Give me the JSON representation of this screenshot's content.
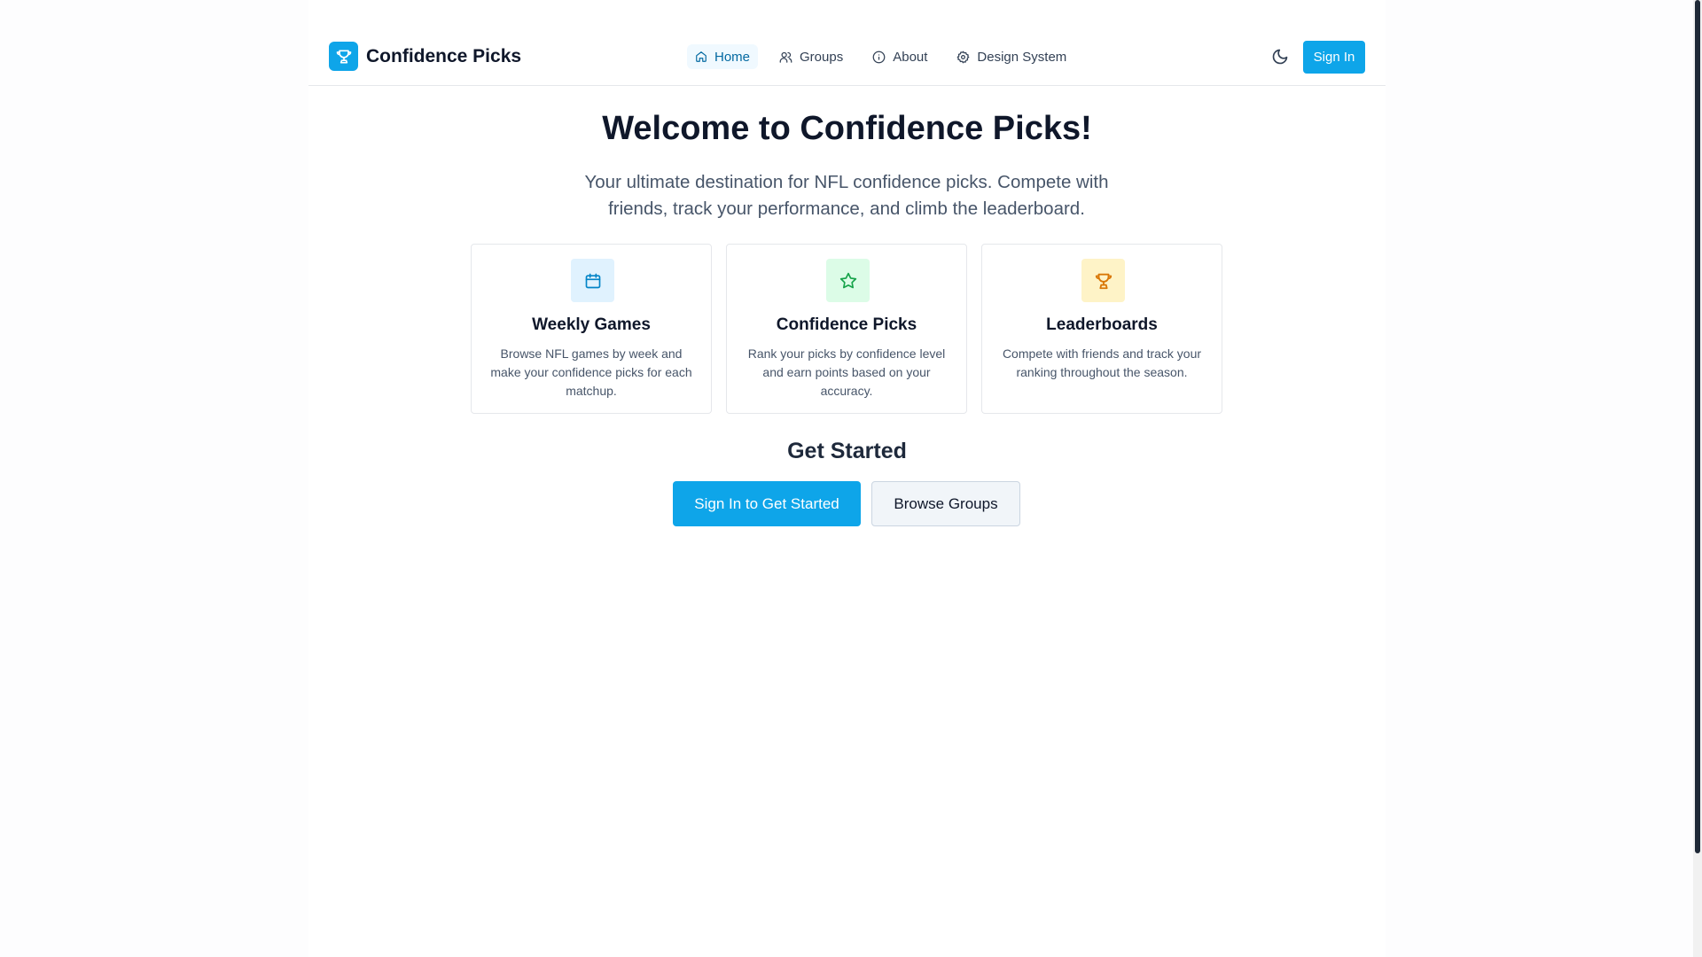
{
  "header": {
    "brand_name": "Confidence Picks",
    "nav": [
      {
        "label": "Home",
        "icon": "home-icon",
        "active": true
      },
      {
        "label": "Groups",
        "icon": "users-icon",
        "active": false
      },
      {
        "label": "About",
        "icon": "info-icon",
        "active": false
      },
      {
        "label": "Design System",
        "icon": "gear-icon",
        "active": false
      }
    ],
    "theme_toggle_icon": "moon-icon",
    "sign_in_label": "Sign In"
  },
  "hero": {
    "title": "Welcome to Confidence Picks!",
    "subtitle": "Your ultimate destination for NFL confidence picks. Compete with friends, track your performance, and climb the leaderboard."
  },
  "features": [
    {
      "icon": "calendar-icon",
      "title": "Weekly Games",
      "text": "Browse NFL games by week and make your confidence picks for each matchup."
    },
    {
      "icon": "star-icon",
      "title": "Confidence Picks",
      "text": "Rank your picks by confidence level and earn points based on your accuracy."
    },
    {
      "icon": "trophy-icon",
      "title": "Leaderboards",
      "text": "Compete with friends and track your ranking throughout the season."
    }
  ],
  "get_started": {
    "title": "Get Started",
    "primary_label": "Sign In to Get Started",
    "secondary_label": "Browse Groups"
  },
  "colors": {
    "accent": "#0ea5e9",
    "calendar_bg": "#e0f2fe",
    "star_bg": "#dcfce7",
    "trophy_bg": "#fef3c7"
  }
}
